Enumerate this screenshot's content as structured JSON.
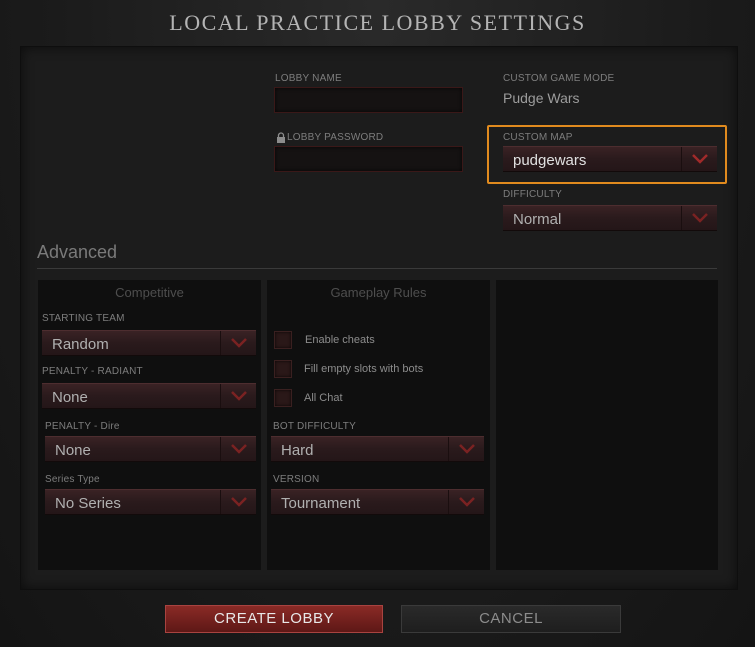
{
  "window": {
    "title": "LOCAL PRACTICE LOBBY SETTINGS"
  },
  "lobby": {
    "name_label": "LOBBY NAME",
    "name_value": "",
    "password_label": "LOBBY PASSWORD",
    "password_value": ""
  },
  "custom_game_mode": {
    "label": "CUSTOM GAME MODE",
    "value": "Pudge Wars"
  },
  "custom_map": {
    "label": "CUSTOM MAP",
    "value": "pudgewars"
  },
  "difficulty": {
    "label": "DIFFICULTY",
    "value": "Normal"
  },
  "advanced": {
    "title": "Advanced",
    "competitive": {
      "title": "Competitive",
      "starting_team": {
        "label": "STARTING TEAM",
        "value": "Random"
      },
      "penalty_radiant": {
        "label": "PENALTY - RADIANT",
        "value": "None"
      },
      "penalty_dire": {
        "label": "PENALTY - Dire",
        "value": "None"
      },
      "series_type": {
        "label": "Series Type",
        "value": "No Series"
      }
    },
    "gameplay_rules": {
      "title": "Gameplay Rules",
      "checkboxes": [
        {
          "label": "Enable cheats",
          "checked": false
        },
        {
          "label": "Fill empty slots with bots",
          "checked": false
        },
        {
          "label": "All Chat",
          "checked": false
        }
      ],
      "bot_difficulty": {
        "label": "BOT DIFFICULTY",
        "value": "Hard"
      },
      "version": {
        "label": "VERSION",
        "value": "Tournament"
      }
    }
  },
  "buttons": {
    "create": "CREATE LOBBY",
    "cancel": "CANCEL"
  },
  "icons": {
    "password": "lock-icon",
    "dropdown": "chevron-down-icon"
  },
  "colors": {
    "highlight": "#e08a1e",
    "accent_red": "#8a2a26",
    "dropdown_arrow": "#9a2a2a"
  }
}
